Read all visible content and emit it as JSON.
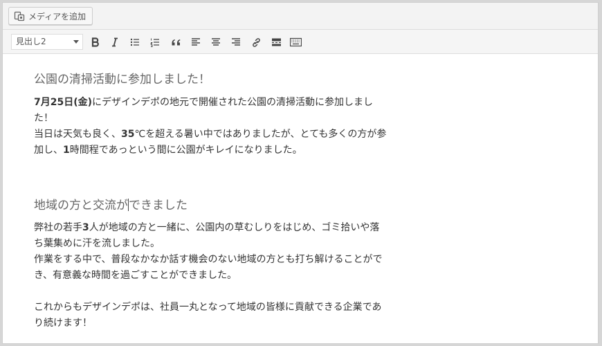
{
  "media_button": {
    "label": "メディアを追加",
    "icon": "media-add-icon"
  },
  "toolbar": {
    "format_select_value": "見出し2",
    "buttons": [
      {
        "name": "bold",
        "icon": "bold-icon"
      },
      {
        "name": "italic",
        "icon": "italic-icon"
      },
      {
        "name": "bullet-list",
        "icon": "bullet-list-icon"
      },
      {
        "name": "numbered-list",
        "icon": "numbered-list-icon"
      },
      {
        "name": "blockquote",
        "icon": "blockquote-icon"
      },
      {
        "name": "align-left",
        "icon": "align-left-icon"
      },
      {
        "name": "align-center",
        "icon": "align-center-icon"
      },
      {
        "name": "align-right",
        "icon": "align-right-icon"
      },
      {
        "name": "link",
        "icon": "link-icon"
      },
      {
        "name": "read-more",
        "icon": "read-more-icon"
      },
      {
        "name": "toolbar-toggle",
        "icon": "keyboard-icon"
      }
    ]
  },
  "content": {
    "heading1": "公園の清掃活動に参加しました！",
    "p1": {
      "line1_pre": "7月25日(金)",
      "line1_post": "にデザインデポの地元で開催された公園の清掃活動に参加しまし",
      "line2": "た！",
      "line3_pre": "当日は天気も良く、",
      "line3_bold": "35",
      "line3_post": "℃を超える暑い中ではありましたが、とても多くの方が参",
      "line4_pre": "加し、",
      "line4_bold": "1",
      "line4_post": "時間程であっという間に公園がキレイになりました。"
    },
    "heading2_pre": "地域の方と交流が",
    "heading2_post": "できました",
    "p2": {
      "line1_pre": "弊社の若手",
      "line1_bold": "3",
      "line1_post": "人が地域の方と一緒に、公園内の草むしりをはじめ、ゴミ拾いや落",
      "line2": "ち葉集めに汗を流しました。",
      "line3": "作業をする中で、普段なかなか話す機会のない地域の方とも打ち解けることがで",
      "line4": "き、有意義な時間を過ごすことができました。"
    },
    "p3": {
      "line1": "これからもデザインデポは、社員一丸となって地域の皆様に貢献できる企業であ",
      "line2": "り続けます！"
    }
  }
}
